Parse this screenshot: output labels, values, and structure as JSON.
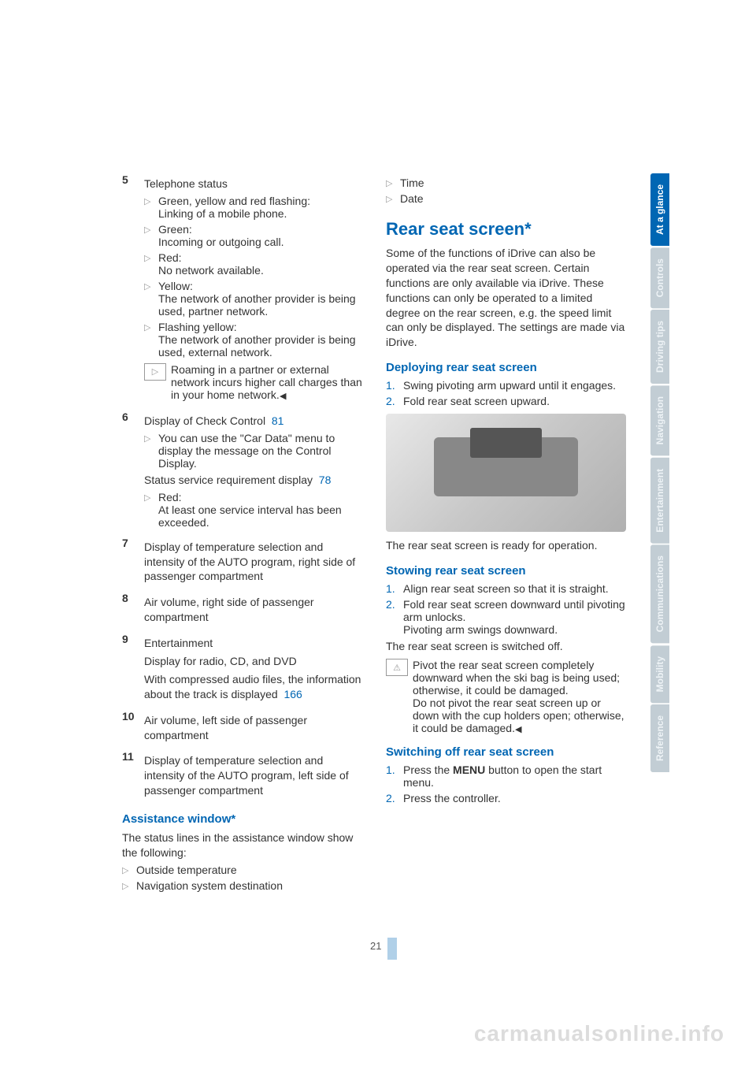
{
  "left": {
    "item5": {
      "num": "5",
      "title": "Telephone status",
      "bullets": [
        {
          "head": "Green, yellow and red flashing:",
          "body": "Linking of a mobile phone."
        },
        {
          "head": "Green:",
          "body": "Incoming or outgoing call."
        },
        {
          "head": "Red:",
          "body": "No network available."
        },
        {
          "head": "Yellow:",
          "body": "The network of another provider is being used, partner network."
        },
        {
          "head": "Flashing yellow:",
          "body": "The network of another provider is being used, external network."
        }
      ],
      "note": "Roaming in a partner or external network incurs higher call charges than in your home network."
    },
    "item6": {
      "num": "6",
      "title_a": "Display of Check Control",
      "ref_a": "81",
      "bullet1": "You can use the \"Car Data\" menu to display the message on the Control Display.",
      "status_line": "Status service requirement display",
      "ref_b": "78",
      "bullet2_head": "Red:",
      "bullet2_body": "At least one service interval has been exceeded."
    },
    "item7": {
      "num": "7",
      "text": "Display of temperature selection and intensity of the AUTO program, right side of passenger compartment"
    },
    "item8": {
      "num": "8",
      "text": "Air volume, right side of passenger compartment"
    },
    "item9": {
      "num": "9",
      "line1": "Entertainment",
      "line2": "Display for radio, CD, and DVD",
      "line3a": "With compressed audio files, the information about the track is displayed",
      "ref": "166"
    },
    "item10": {
      "num": "10",
      "text": "Air volume, left side of passenger compartment"
    },
    "item11": {
      "num": "11",
      "text": "Display of temperature selection and intensity of the AUTO program, left side of passenger compartment"
    },
    "assist": {
      "heading": "Assistance window*",
      "intro": "The status lines in the assistance window show the following:",
      "bullets": [
        "Outside temperature",
        "Navigation system destination"
      ]
    }
  },
  "right": {
    "top_bullets": [
      "Time",
      "Date"
    ],
    "rear": {
      "heading": "Rear seat screen*",
      "intro": "Some of the functions of iDrive can also be operated via the rear seat screen. Certain functions are only available via iDrive. These functions can only be operated to a limited degree on the rear screen, e.g. the speed limit can only be displayed. The settings are made via iDrive."
    },
    "deploy": {
      "heading": "Deploying rear seat screen",
      "steps": [
        "Swing pivoting arm upward until it engages.",
        "Fold rear seat screen upward."
      ],
      "caption": "The rear seat screen is ready for operation."
    },
    "stow": {
      "heading": "Stowing rear seat screen",
      "steps": [
        "Align rear seat screen so that it is straight.",
        "Fold rear seat screen downward until pivoting arm unlocks.\nPivoting arm swings downward."
      ],
      "off_line": "The rear seat screen is switched off.",
      "warn": "Pivot the rear seat screen completely downward when the ski bag is being used; otherwise, it could be damaged.\nDo not pivot the rear seat screen up or down with the cup holders open; otherwise, it could be damaged."
    },
    "switch": {
      "heading": "Switching off rear seat screen",
      "step1_a": "Press the ",
      "step1_b": "MENU",
      "step1_c": " button to open the start menu.",
      "step2": "Press the controller."
    }
  },
  "page_number": "21",
  "tabs": [
    "At a glance",
    "Controls",
    "Driving tips",
    "Navigation",
    "Entertainment",
    "Communications",
    "Mobility",
    "Reference"
  ],
  "watermark": "carmanualsonline.info"
}
